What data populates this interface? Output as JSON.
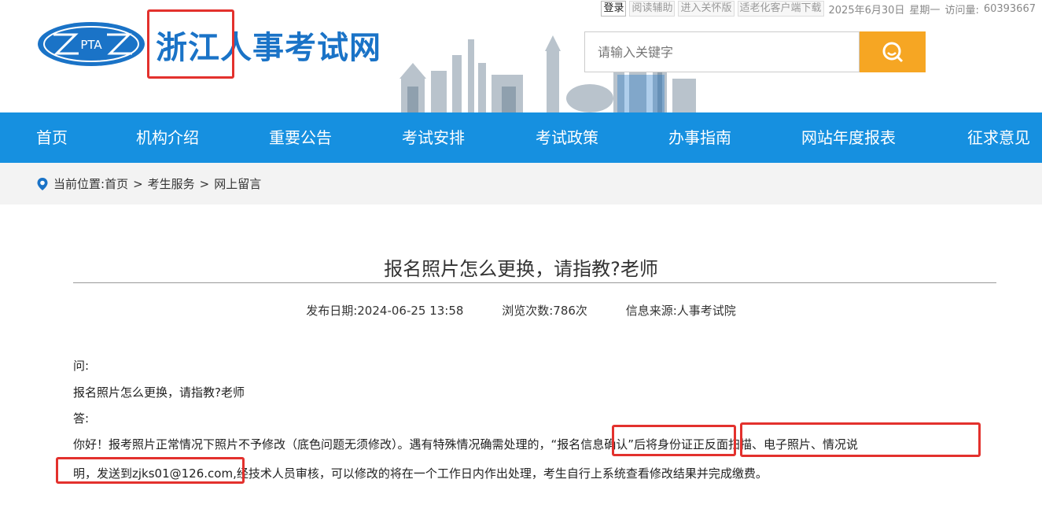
{
  "topbar": {
    "login": "登录",
    "reading_aid": "阅读辅助",
    "care_version": "进入关怀版",
    "elderly_client": "适老化客户端下载",
    "date": "2025年6月30日",
    "weekday": "星期一",
    "visits_label": "访问量:",
    "visits_value": "60393667"
  },
  "header": {
    "logo_text": "PTA",
    "site_title": "浙江人事考试网",
    "search_placeholder": "请输入关键字"
  },
  "nav": {
    "items": [
      "首页",
      "机构介绍",
      "重要公告",
      "考试安排",
      "考试政策",
      "办事指南",
      "网站年度报表",
      "征求意见"
    ]
  },
  "breadcrumb": {
    "label": "当前位置:",
    "items": [
      "首页",
      "考生服务",
      "网上留言"
    ],
    "separator": ">"
  },
  "article": {
    "title": "报名照片怎么更换，请指教?老师",
    "publish_label": "发布日期:",
    "publish_date": "2024-06-25 13:58",
    "views_label": "浏览次数:",
    "views_value": "786次",
    "source_label": "信息来源:",
    "source_value": "人事考试院",
    "q_label": "问:",
    "question": "报名照片怎么更换，请指教?老师",
    "a_label": "答:",
    "answer_line1": "你好！报考照片正常情况下照片不予修改（底色问题无须修改）。遇有特殊情况确需处理的，“报名信息确认”后将身份证正反面扫描、电子照片、情况说",
    "answer_line2": "明，发送到zjks01@126.com,经技术人员审核，可以修改的将在一个工作日内作出处理，考生自行上系统查看修改结果并完成缴费。"
  },
  "colors": {
    "brand_blue": "#1690e0",
    "title_blue": "#1a73c7",
    "search_orange": "#f6a623",
    "highlight_red": "#e3312d"
  }
}
